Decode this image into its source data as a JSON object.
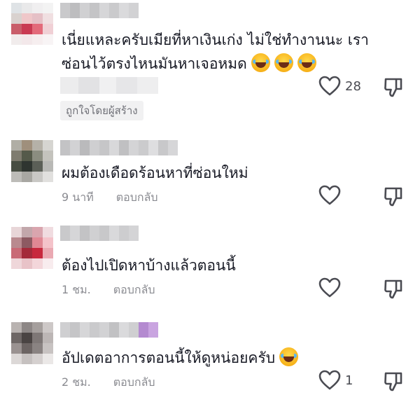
{
  "comments": [
    {
      "text_line1": "เนี่ยแหละครับเมียที่หาเงินเก่ง ไม่ใช่ทำงานนะ เรา",
      "text_line2": "ซ่อนไว้ตรงไหนมันหาเจอหมด",
      "emoji_count": 3,
      "likes": "28",
      "badge": "ถูกใจโดยผู้สร้าง",
      "avatar": [
        "#dfe3e6",
        "#e9e9ea",
        "#f0eff0",
        "#f3f3f3",
        "#d9d2cf",
        "#efc7c9",
        "#e5c0c6",
        "#f0dfe1",
        "#c95e6a",
        "#c93a52",
        "#e36a7a",
        "#f0d0d5",
        "#f1ecec",
        "#f3e8ea",
        "#f6eeef",
        "#f8f4f5"
      ],
      "username_blocks": [
        "#c9c9cb",
        "#bdbdbf",
        "#d0d0d2",
        "#c4c4c6",
        "#d6d6d8",
        "#cacacc",
        "#dadadc",
        "#d2d2d4"
      ]
    },
    {
      "text": "ผมต้องเดือดร้อนหาที่ซ่อนใหม่",
      "time": "9 นาที",
      "reply": "ตอบกลับ",
      "likes": "",
      "avatar": [
        "#b0aea5",
        "#9f8f7c",
        "#b5b1a8",
        "#d6d5d1",
        "#7f7c6f",
        "#555a4a",
        "#8b8d80",
        "#c4c3bd",
        "#474d42",
        "#2f3530",
        "#5b5f57",
        "#b9b9b6",
        "#bdbcb8",
        "#a8a7a2",
        "#c9c8c5",
        "#e1e0de"
      ],
      "username_blocks": [
        "#c3c3c5",
        "#d2d2d4",
        "#bababc",
        "#cfcfd1",
        "#c6c6c8",
        "#d8d8da",
        "#c0c0c2",
        "#d4d4d6",
        "#cbcbcd",
        "#dedee0",
        "#c8c8ca",
        "#d6d6d8"
      ]
    },
    {
      "text": "ต้องไปเปิดหาบ้างแล้วตอนนี้",
      "time": "1 ชม.",
      "reply": "ตอบกลับ",
      "likes": "",
      "avatar": [
        "#e8d6d8",
        "#c2a7ab",
        "#d9a5ae",
        "#f0dce0",
        "#b98a8f",
        "#8d5a62",
        "#e08894",
        "#f4c3ca",
        "#c96a76",
        "#a42a3a",
        "#c7283d",
        "#eaa9b2",
        "#efd7da",
        "#e8c3c8",
        "#f3d6da",
        "#f8ecee"
      ],
      "username_blocks": [
        "#c9c9cb",
        "#d6d6d8",
        "#c3c3c5",
        "#d0d0d2",
        "#c8c8ca",
        "#d9d9db",
        "#cdcdcf",
        "#d4d4d6"
      ]
    },
    {
      "text": "อัปเดตอาการตอนนี้ให้ดูหน่อยครับ",
      "time": "2 ชม.",
      "reply": "ตอบกลับ",
      "likes": "1",
      "avatar": [
        "#b9b3b1",
        "#8d8786",
        "#a59f9d",
        "#cdc8c7",
        "#6e6766",
        "#4a4443",
        "#7e7776",
        "#bcb6b5",
        "#9a9291",
        "#6c6463",
        "#8a8382",
        "#c8c3c2",
        "#dcd8d7",
        "#c6c1c0",
        "#d5d0cf",
        "#ebe8e7"
      ],
      "username_blocks": [
        "#cfcfd1",
        "#c5c5c7",
        "#d6d6d8",
        "#cacacc",
        "#d2d2d4",
        "#c1c1c3",
        "#dadadc",
        "#cfcfd1",
        "#b48ad0",
        "#c9a4e0"
      ]
    }
  ]
}
